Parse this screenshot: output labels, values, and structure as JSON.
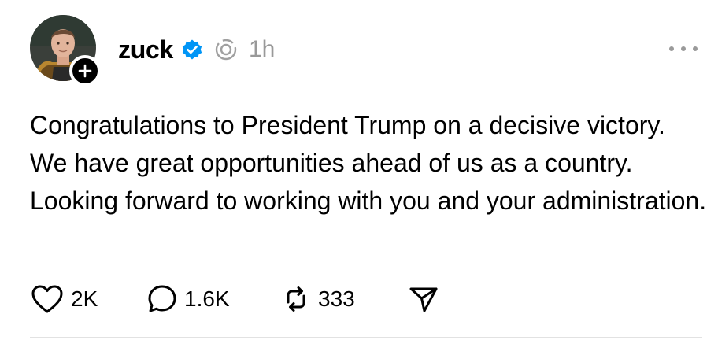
{
  "post": {
    "username": "zuck",
    "time": "1h",
    "text": "Congratulations to President Trump on a decisive victory. We have great opportunities ahead of us as a country. Looking forward to working with you and your administration.",
    "icons": {
      "avatar": "profile-photo",
      "follow": "plus-icon",
      "verified": "verified-badge-icon",
      "threads": "threads-ring-icon",
      "more": "more-icon"
    }
  },
  "actions": {
    "like_count": "2K",
    "reply_count": "1.6K",
    "repost_count": "333",
    "icons": [
      "heart-icon",
      "reply-bubble-icon",
      "repost-icon",
      "share-icon"
    ]
  },
  "colors": {
    "verified": "#0095F6",
    "muted": "#999999",
    "divider": "#E2E2E2"
  }
}
